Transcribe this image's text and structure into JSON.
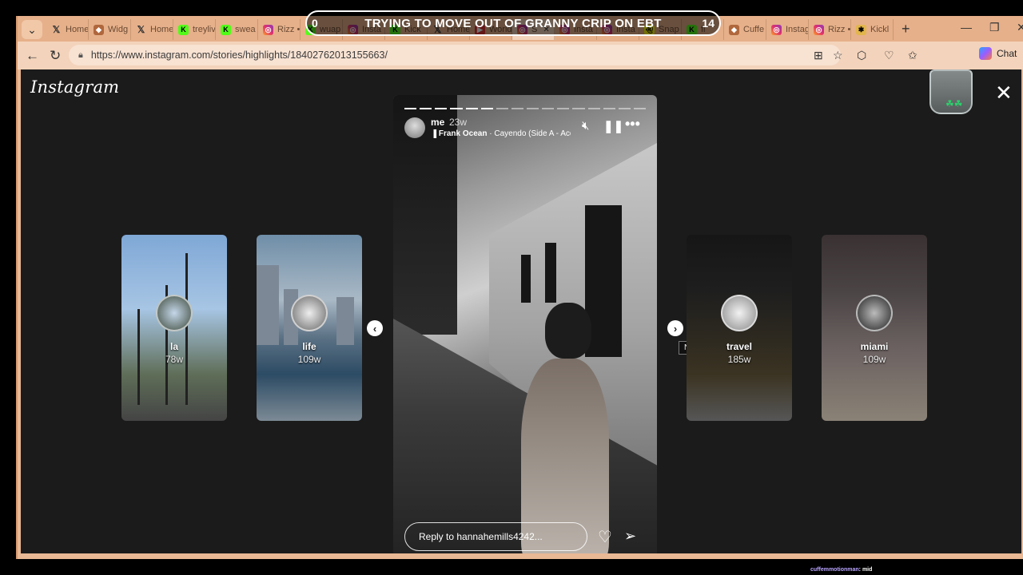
{
  "stream_banner": {
    "left_count": "0",
    "title": "TRYING TO MOVE OUT OF GRANNY CRIP ON EBT",
    "right_count": "14"
  },
  "tabs": [
    {
      "label": "Home",
      "icon": "x-icon"
    },
    {
      "label": "Widg",
      "icon": "widget-icon"
    },
    {
      "label": "Home",
      "icon": "x-icon"
    },
    {
      "label": "treyliv",
      "icon": "kick-icon"
    },
    {
      "label": "swea",
      "icon": "kick-icon"
    },
    {
      "label": "Rizz •",
      "icon": "instagram-icon"
    },
    {
      "label": "wuap",
      "icon": "kick-icon"
    },
    {
      "label": "Insta",
      "icon": "instagram-icon"
    },
    {
      "label": "Kick",
      "icon": "kick-icon"
    },
    {
      "label": "Home",
      "icon": "x-icon"
    },
    {
      "label": "World",
      "icon": "youtube-icon"
    },
    {
      "label": "S",
      "icon": "instagram-icon",
      "active": true
    },
    {
      "label": "Insta",
      "icon": "instagram-icon"
    },
    {
      "label": "Insta",
      "icon": "instagram-icon"
    },
    {
      "label": "Snap",
      "icon": "snapchat-icon"
    },
    {
      "label": "fi",
      "icon": "kick-icon"
    },
    {
      "label": "Cuffe",
      "icon": "widget-icon"
    },
    {
      "label": "Instag",
      "icon": "instagram-icon"
    },
    {
      "label": "Rizz •",
      "icon": "instagram-icon"
    },
    {
      "label": "Kickl",
      "icon": "star-icon"
    }
  ],
  "address_bar": {
    "url": "https://www.instagram.com/stories/highlights/18402762013155663/",
    "chat_label": "Chat"
  },
  "instagram": {
    "logo": "Instagram",
    "highlights": [
      {
        "label": "la",
        "age": "78w"
      },
      {
        "label": "life",
        "age": "109w"
      },
      {
        "label": "travel",
        "age": "185w"
      },
      {
        "label": "miami",
        "age": "109w"
      }
    ],
    "story": {
      "username": "me",
      "time": "23w",
      "music_artist": "Frank Ocean",
      "music_track": "· Cayendo (Side A - Aco",
      "progress_total": 16,
      "progress_done": 6,
      "reply_placeholder": "Reply to hannahemills4242..."
    },
    "tooltip": "Next"
  },
  "footer_chat": {
    "user": "cuffemmotionman",
    "message": ": mid"
  }
}
